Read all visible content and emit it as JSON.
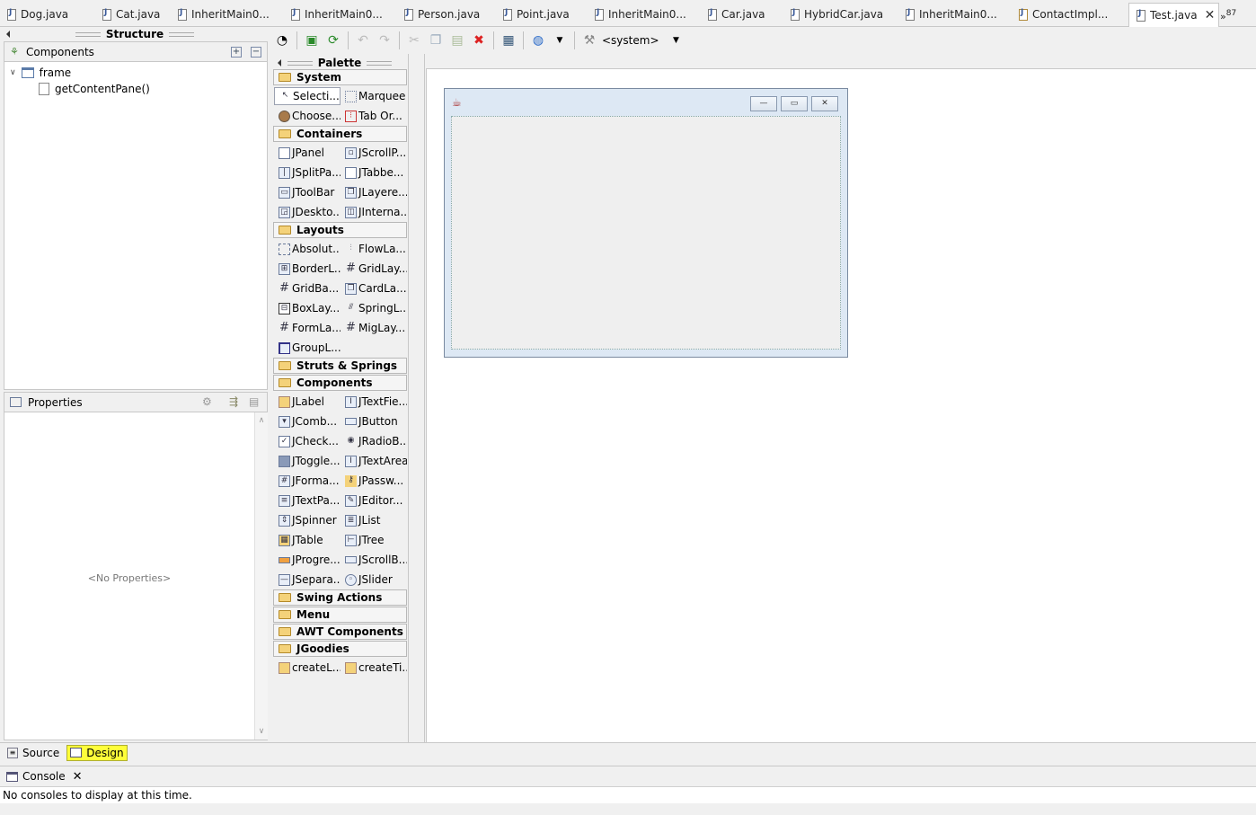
{
  "editor_tabs": [
    {
      "label": "Dog.java"
    },
    {
      "label": "Cat.java"
    },
    {
      "label": "InheritMain0..."
    },
    {
      "label": "InheritMain0..."
    },
    {
      "label": "Person.java"
    },
    {
      "label": "Point.java"
    },
    {
      "label": "InheritMain0..."
    },
    {
      "label": "Car.java"
    },
    {
      "label": "HybridCar.java"
    },
    {
      "label": "InheritMain0..."
    },
    {
      "label": "ContactImpl..."
    },
    {
      "label": "Test.java"
    }
  ],
  "overflow_count": "87",
  "structure": {
    "title": "Structure",
    "components_label": "Components",
    "tree": [
      {
        "label": "frame"
      },
      {
        "label": "getContentPane()"
      }
    ],
    "properties_label": "Properties",
    "no_properties": "<No Properties>"
  },
  "toolbar": {
    "system_label": "<system>"
  },
  "palette": {
    "title": "Palette",
    "categories": {
      "system": "System",
      "containers": "Containers",
      "layouts": "Layouts",
      "struts": "Struts & Springs",
      "components": "Components",
      "swing_actions": "Swing Actions",
      "menu": "Menu",
      "awt": "AWT Components",
      "jgoodies": "JGoodies"
    },
    "system_items": [
      "Selecti...",
      "Marquee",
      "Choose...",
      "Tab Or..."
    ],
    "container_items": [
      "JPanel",
      "JScrollP...",
      "JSplitPa...",
      "JTabbe...",
      "JToolBar",
      "JLayere...",
      "JDeskto...",
      "JInterna..."
    ],
    "layout_items": [
      "Absolut...",
      "FlowLa...",
      "BorderL...",
      "GridLay...",
      "GridBa...",
      "CardLa...",
      "BoxLay...",
      "SpringL...",
      "FormLa...",
      "MigLay...",
      "GroupL..."
    ],
    "component_items": [
      "JLabel",
      "JTextFie...",
      "JComb...",
      "JButton",
      "JCheck...",
      "JRadioB...",
      "JToggle...",
      "JTextArea",
      "JForma...",
      "JPassw...",
      "JTextPa...",
      "JEditor...",
      "JSpinner",
      "JList",
      "JTable",
      "JTree",
      "JProgre...",
      "JScrollB...",
      "JSepara...",
      "JSlider"
    ],
    "jgoodies_items": [
      "createL...",
      "createTi..."
    ]
  },
  "bottom_tabs": {
    "source": "Source",
    "design": "Design"
  },
  "console": {
    "title": "Console",
    "message": "No consoles to display at this time."
  },
  "colors": {
    "design_tab_highlight": "#ffff3a",
    "folder": "#f4d27a",
    "frame_border": "#7a8aa0"
  }
}
